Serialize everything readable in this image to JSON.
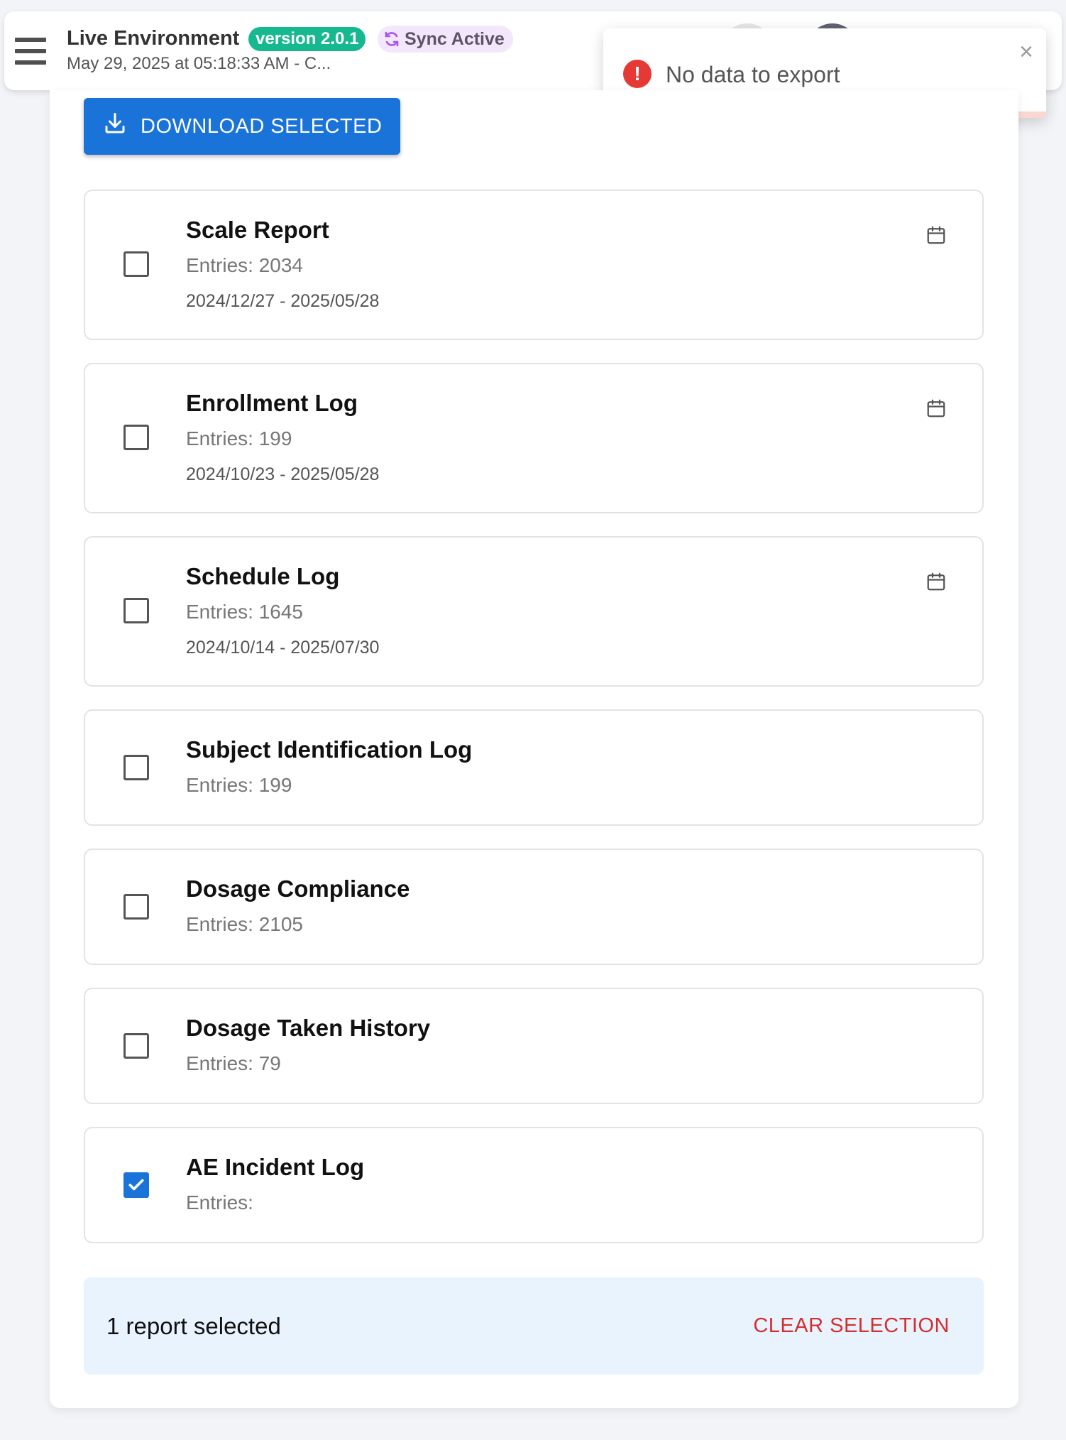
{
  "header": {
    "title": "Live Environment",
    "version_badge": "version 2.0.1",
    "sync_badge": "Sync Active",
    "subtitle": "May 29, 2025 at 05:18:33 AM - C..."
  },
  "toast": {
    "message": "No data to export",
    "close_label": "×",
    "progress": 0.22
  },
  "actions": {
    "download_label": "DOWNLOAD SELECTED"
  },
  "reports": [
    {
      "title": "Scale Report",
      "entries": "Entries: 2034",
      "range": "2024/12/27 - 2025/05/28",
      "checked": false,
      "has_calendar": true
    },
    {
      "title": "Enrollment Log",
      "entries": "Entries: 199",
      "range": "2024/10/23 - 2025/05/28",
      "checked": false,
      "has_calendar": true
    },
    {
      "title": "Schedule Log",
      "entries": "Entries: 1645",
      "range": "2024/10/14 - 2025/07/30",
      "checked": false,
      "has_calendar": true
    },
    {
      "title": "Subject Identification Log",
      "entries": "Entries: 199",
      "checked": false,
      "has_calendar": false
    },
    {
      "title": "Dosage Compliance",
      "entries": "Entries: 2105",
      "checked": false,
      "has_calendar": false
    },
    {
      "title": "Dosage Taken History",
      "entries": "Entries: 79",
      "checked": false,
      "has_calendar": false
    },
    {
      "title": "AE Incident Log",
      "entries": "Entries:",
      "checked": true,
      "has_calendar": false
    }
  ],
  "selection": {
    "summary": "1 report selected",
    "clear_label": "CLEAR SELECTION"
  },
  "colors": {
    "primary": "#1a73d9",
    "version_badge": "#16b98f",
    "sync_badge_bg": "#f3e7fc",
    "sync_icon": "#a855f7",
    "error": "#e53935",
    "clear_text": "#d32f2f",
    "selection_bg": "#e9f3fd"
  },
  "icons": {
    "menu": "hamburger-icon",
    "sync": "sync-icon",
    "toast": "error-icon",
    "download": "download-icon",
    "calendar": "calendar-icon",
    "check": "check-icon"
  }
}
